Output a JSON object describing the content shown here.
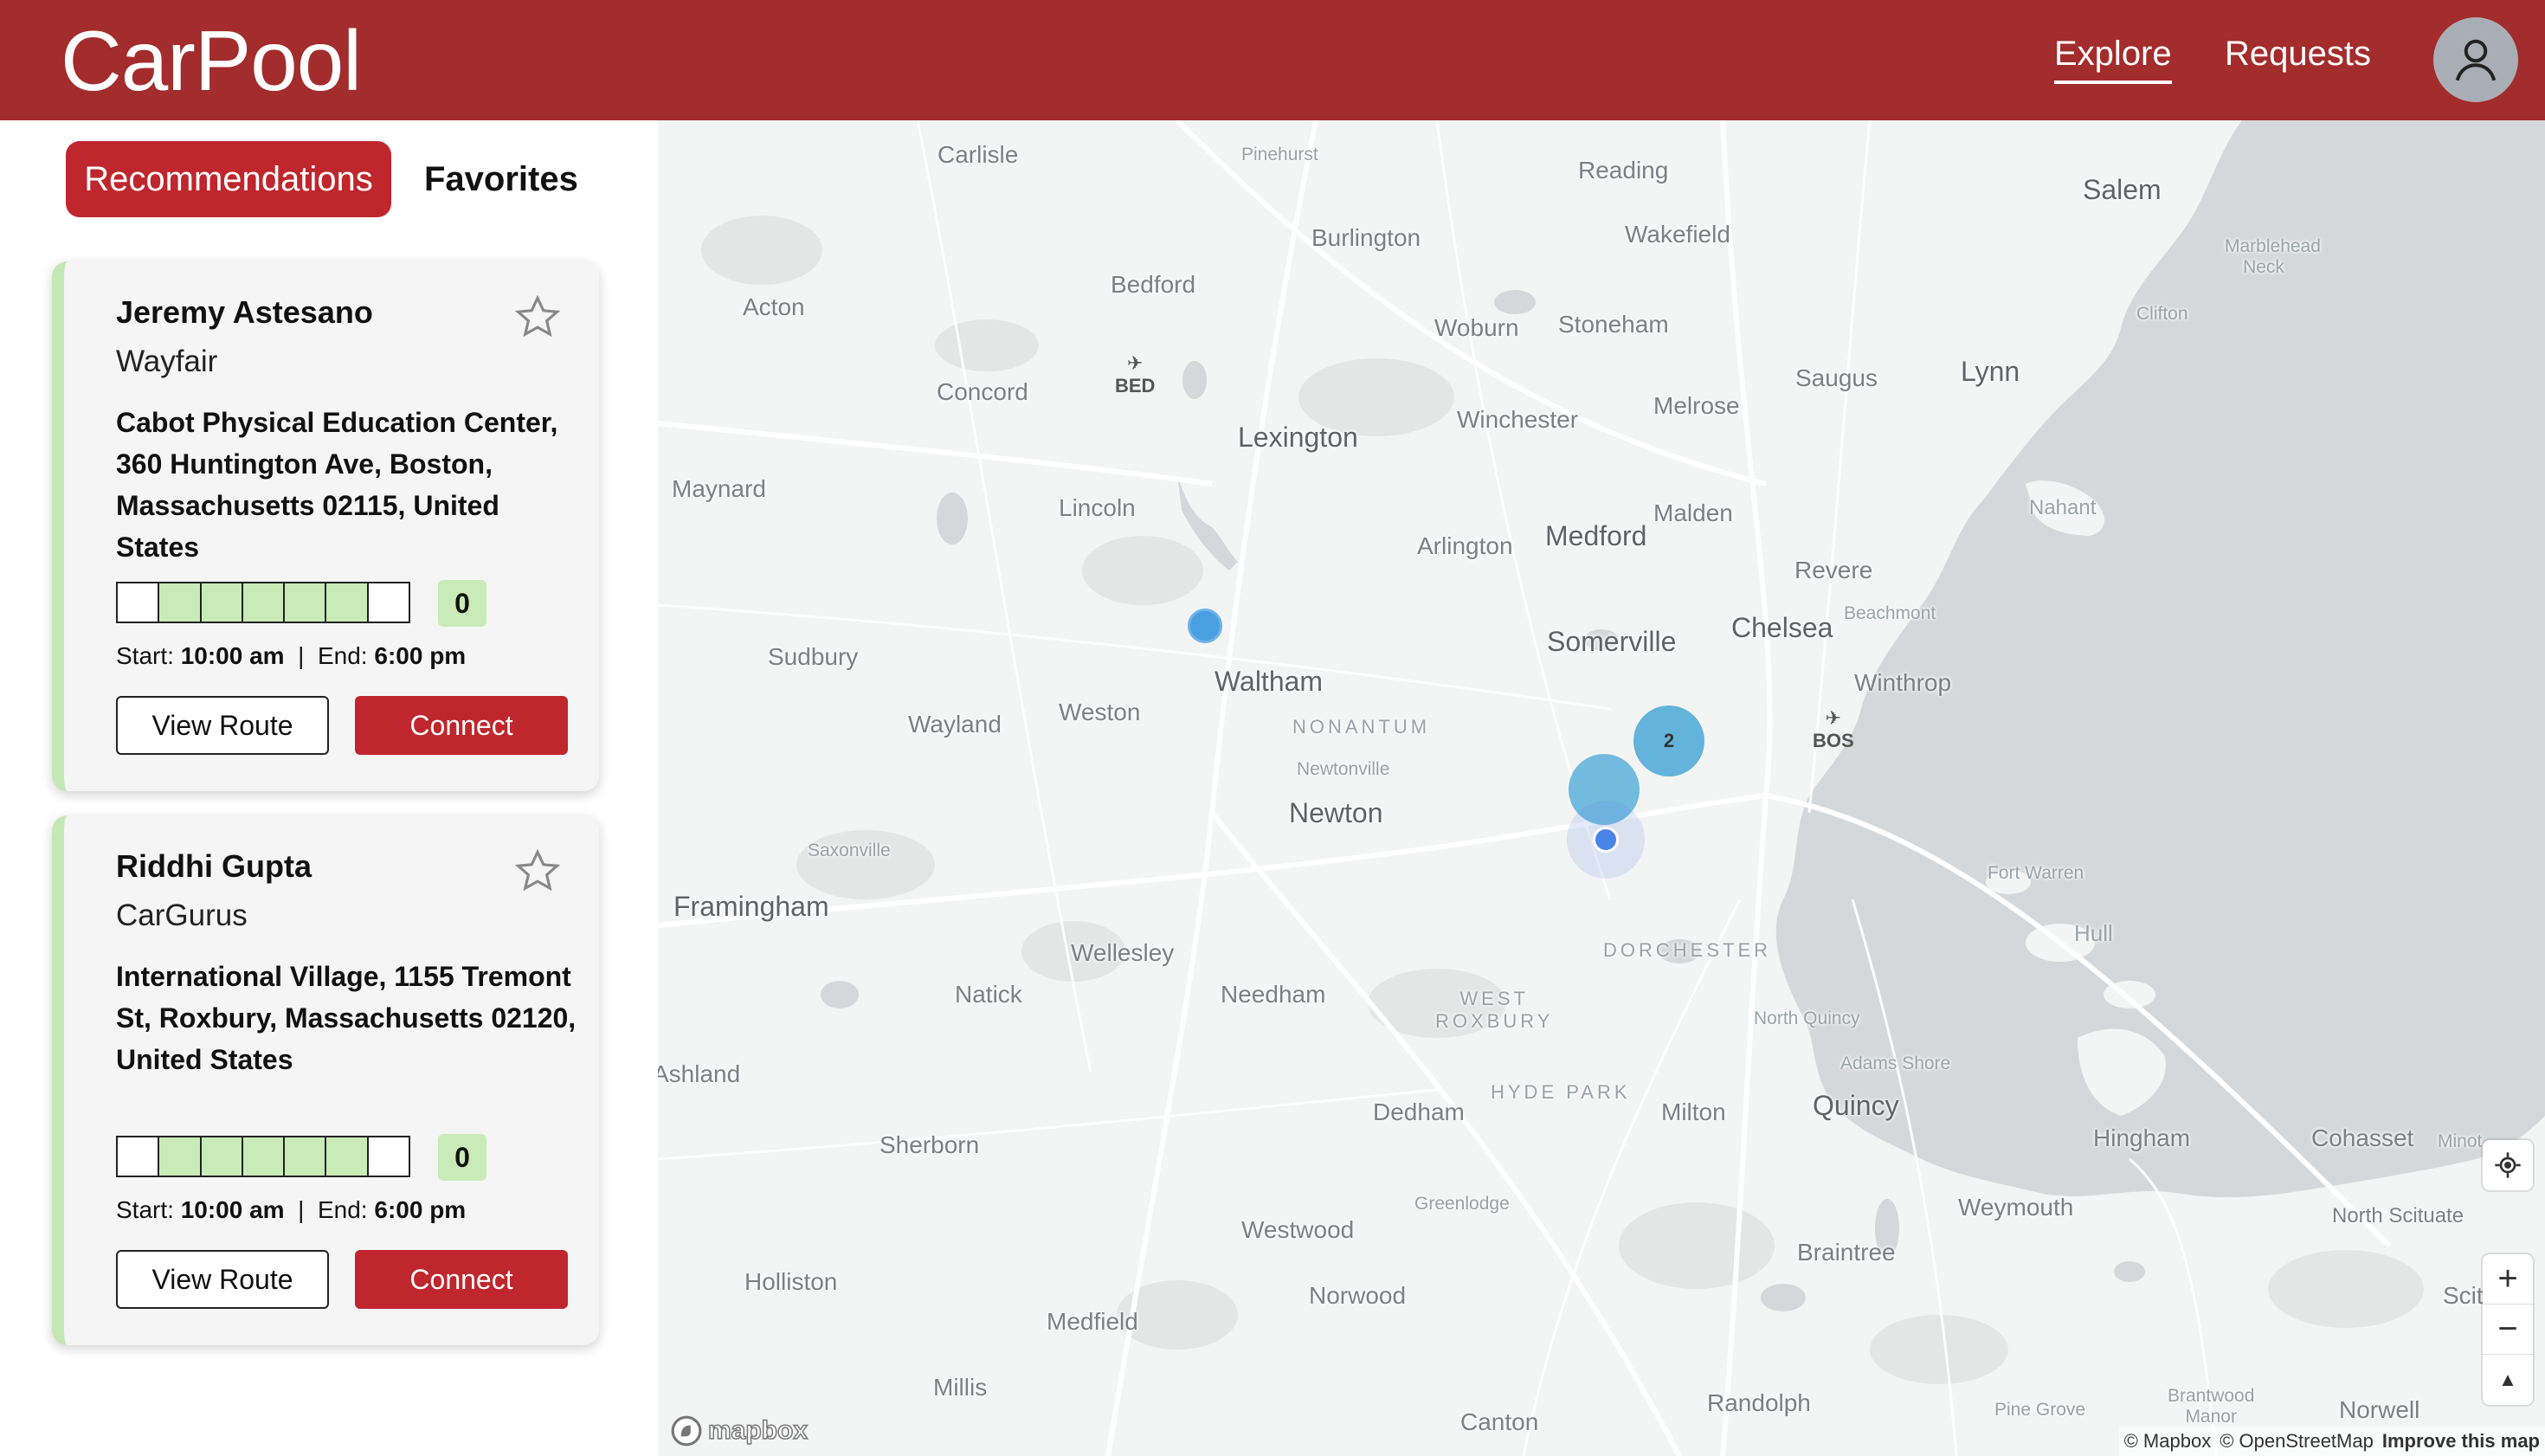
{
  "header": {
    "brand": "CarPool",
    "nav": {
      "explore": "Explore",
      "requests": "Requests"
    },
    "colors": {
      "header_bg": "#a32c2c"
    }
  },
  "sidebar": {
    "tabs": {
      "recommendations": "Recommendations",
      "favorites": "Favorites"
    },
    "cards": [
      {
        "name": "Jeremy Astesano",
        "company": "Wayfair",
        "address": "Cabot Physical Education Center, 360 Huntington Ave, Boston, Massachusetts 02115, United States",
        "seats_total": 7,
        "seats_filled_start": 1,
        "seats_filled_end": 6,
        "count": "0",
        "start_label": "Start:",
        "start_time": "10:00 am",
        "separator": "|",
        "end_label": "End:",
        "end_time": "6:00 pm",
        "view_route": "View Route",
        "connect": "Connect"
      },
      {
        "name": "Riddhi Gupta",
        "company": "CarGurus",
        "address": "International Village, 1155 Tremont St, Roxbury, Massachusetts 02120, United States",
        "seats_total": 7,
        "seats_filled_start": 1,
        "seats_filled_end": 6,
        "count": "0",
        "start_label": "Start:",
        "start_time": "10:00 am",
        "separator": "|",
        "end_label": "End:",
        "end_time": "6:00 pm",
        "view_route": "View Route",
        "connect": "Connect"
      }
    ]
  },
  "map": {
    "places": {
      "carlisle": "Carlisle",
      "pinehurst": "Pinehurst",
      "reading": "Reading",
      "salem": "Salem",
      "burlington": "Burlington",
      "wakefield": "Wakefield",
      "marblehead_neck": "Marblehead Neck",
      "acton": "Acton",
      "bedford": "Bedford",
      "woburn": "Woburn",
      "stoneham": "Stoneham",
      "clifton": "Clifton",
      "concord": "Concord",
      "saugus": "Saugus",
      "lynn": "Lynn",
      "lexington": "Lexington",
      "winchester": "Winchester",
      "melrose": "Melrose",
      "maynard": "Maynard",
      "lincoln": "Lincoln",
      "nahant": "Nahant",
      "malden": "Malden",
      "arlington": "Arlington",
      "medford": "Medford",
      "revere": "Revere",
      "beachmont": "Beachmont",
      "sudbury": "Sudbury",
      "chelsea": "Chelsea",
      "somerville": "Somerville",
      "waltham": "Waltham",
      "winthrop": "Winthrop",
      "wayland": "Wayland",
      "weston": "Weston",
      "nonantum": "NONANTUM",
      "newtonville": "Newtonville",
      "newton": "Newton",
      "saxonville": "Saxonville",
      "framingham": "Framingham",
      "fort_warren": "Fort Warren",
      "hull": "Hull",
      "wellesley": "Wellesley",
      "dorchester": "DORCHESTER",
      "natick": "Natick",
      "needham": "Needham",
      "west_roxbury": "WEST\nROXBURY",
      "north_quincy": "North Quincy",
      "ashland": "Ashland",
      "adams_shore": "Adams Shore",
      "hyde_park": "HYDE PARK",
      "dedham": "Dedham",
      "milton": "Milton",
      "quincy": "Quincy",
      "sherborn": "Sherborn",
      "hingham": "Hingham",
      "cohasset": "Cohasset",
      "minot": "Minot",
      "greenlodge": "Greenlodge",
      "weymouth": "Weymouth",
      "north_scituate": "North Scituate",
      "westwood": "Westwood",
      "braintree": "Braintree",
      "holliston": "Holliston",
      "norwood": "Norwood",
      "scituate": "Scituate",
      "medfield": "Medfield",
      "millis": "Millis",
      "randolph": "Randolph",
      "pine_grove": "Pine Grove",
      "brantwood_manor": "Brantwood\nManor",
      "norwell": "Norwell",
      "canton": "Canton"
    },
    "airports": {
      "bed": "BED",
      "bos": "BOS"
    },
    "cluster_count": "2",
    "controls": {
      "zoom_in": "+",
      "zoom_out": "−",
      "compass": "▲",
      "geolocate": "⌖"
    },
    "logo": "mapbox",
    "attribution": {
      "mapbox": "© Mapbox",
      "osm": "© OpenStreetMap",
      "improve": "Improve this map"
    },
    "colors": {
      "water": "#d5d8da",
      "land": "#f3f4f4",
      "marker": "#4a9fe0",
      "cluster": "#63b3da"
    }
  }
}
